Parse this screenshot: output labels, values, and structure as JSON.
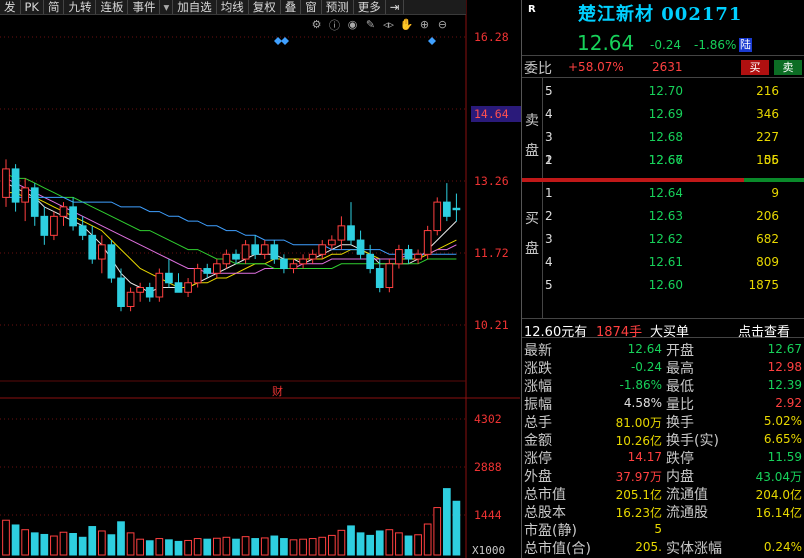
{
  "toolbar": {
    "items": [
      "发",
      "PK",
      "简",
      "九转",
      "连板",
      "事件",
      "▾",
      "加自选",
      "均线",
      "复权",
      "叠",
      "窗",
      "预测",
      "更多"
    ]
  },
  "chart": {
    "price_axis": [
      "16.28",
      "14.64",
      "13.26",
      "11.72",
      "10.21"
    ],
    "volume_axis": [
      "4302",
      "2888",
      "1444"
    ],
    "volume_unit": "X1000",
    "event_marker": "财",
    "current_price_tag": "14.64"
  },
  "stock": {
    "tag": "R",
    "name": "楚江新材",
    "code": "002171",
    "price": "12.64",
    "change": "-0.24",
    "change_pct": "-1.86%",
    "market_badge": "陆"
  },
  "weibi": {
    "label": "委比",
    "ratio": "+58.07%",
    "diff": "2631",
    "buy_label": "买",
    "sell_label": "卖"
  },
  "book": {
    "sell_label_chars": [
      "卖",
      "盘"
    ],
    "buy_label_chars": [
      "买",
      "盘"
    ],
    "asks": [
      {
        "level": "5",
        "price": "12.70",
        "qty": "216"
      },
      {
        "level": "4",
        "price": "12.69",
        "qty": "346"
      },
      {
        "level": "3",
        "price": "12.68",
        "qty": "227"
      },
      {
        "level": "2",
        "price": "12.67",
        "qty": "106"
      },
      {
        "level": "1",
        "price": "12.66",
        "qty": "55"
      }
    ],
    "bids": [
      {
        "level": "1",
        "price": "12.64",
        "qty": "9"
      },
      {
        "level": "2",
        "price": "12.63",
        "qty": "206"
      },
      {
        "level": "3",
        "price": "12.62",
        "qty": "682"
      },
      {
        "level": "4",
        "price": "12.61",
        "qty": "809"
      },
      {
        "level": "5",
        "price": "12.60",
        "qty": "1875"
      }
    ]
  },
  "big_order": {
    "price": "12.60元有",
    "qty": "1874手",
    "label": "大买单",
    "link": "点击查看"
  },
  "stats": [
    {
      "l1": "最新",
      "v1": "12.64",
      "c1": "green",
      "l2": "开盘",
      "v2": "12.67",
      "c2": "green"
    },
    {
      "l1": "涨跌",
      "v1": "-0.24",
      "c1": "green",
      "l2": "最高",
      "v2": "12.98",
      "c2": "red"
    },
    {
      "l1": "涨幅",
      "v1": "-1.86%",
      "c1": "green",
      "l2": "最低",
      "v2": "12.39",
      "c2": "green"
    },
    {
      "l1": "振幅",
      "v1": "4.58%",
      "c1": "white",
      "l2": "量比",
      "v2": "2.92",
      "c2": "red"
    },
    {
      "l1": "总手",
      "v1": "81.00万",
      "c1": "yellow",
      "l2": "换手",
      "v2": "5.02%",
      "c2": "yellow"
    },
    {
      "l1": "金额",
      "v1": "10.26亿",
      "c1": "yellow",
      "l2": "换手(实)",
      "v2": "6.65%",
      "c2": "yellow"
    },
    {
      "l1": "涨停",
      "v1": "14.17",
      "c1": "red",
      "l2": "跌停",
      "v2": "11.59",
      "c2": "green"
    },
    {
      "l1": "外盘",
      "v1": "37.97万",
      "c1": "red",
      "l2": "内盘",
      "v2": "43.04万",
      "c2": "green"
    },
    {
      "l1": "总市值",
      "v1": "205.1亿",
      "c1": "yellow",
      "l2": "流通值",
      "v2": "204.0亿",
      "c2": "yellow"
    },
    {
      "l1": "总股本",
      "v1": "16.23亿",
      "c1": "yellow",
      "l2": "流通股",
      "v2": "16.14亿",
      "c2": "yellow"
    },
    {
      "l1": "市盈(静)",
      "v1": "5",
      "c1": "yellow",
      "l2": "",
      "v2": "",
      "c2": "yellow"
    },
    {
      "l1": "总市值(合)",
      "v1": "205.",
      "c1": "yellow",
      "l2": "实体涨幅",
      "v2": "0.24%",
      "c2": "yellow"
    }
  ],
  "colors": {
    "up": "#ff4040",
    "down": "#17d15a",
    "stock_name": "#00d0ff",
    "ma_white": "#e8e8e8",
    "ma_yellow": "#e8d800",
    "ma_pink": "#e070e0",
    "ma_green": "#30d030",
    "ma_blue": "#3fa0ff"
  },
  "chart_data": {
    "type": "candlestick",
    "ylim": [
      10.21,
      16.28
    ],
    "candles": [
      {
        "o": 12.9,
        "h": 13.7,
        "l": 12.7,
        "c": 13.5
      },
      {
        "o": 13.5,
        "h": 13.6,
        "l": 12.6,
        "c": 12.8
      },
      {
        "o": 12.8,
        "h": 13.3,
        "l": 12.4,
        "c": 13.1
      },
      {
        "o": 13.1,
        "h": 13.2,
        "l": 12.3,
        "c": 12.5
      },
      {
        "o": 12.5,
        "h": 12.7,
        "l": 11.9,
        "c": 12.1
      },
      {
        "o": 12.1,
        "h": 12.6,
        "l": 12.0,
        "c": 12.5
      },
      {
        "o": 12.5,
        "h": 12.8,
        "l": 12.3,
        "c": 12.7
      },
      {
        "o": 12.7,
        "h": 12.9,
        "l": 12.2,
        "c": 12.3
      },
      {
        "o": 12.3,
        "h": 12.5,
        "l": 12.0,
        "c": 12.1
      },
      {
        "o": 12.1,
        "h": 12.3,
        "l": 11.5,
        "c": 11.6
      },
      {
        "o": 11.6,
        "h": 12.1,
        "l": 11.3,
        "c": 11.9
      },
      {
        "o": 11.9,
        "h": 12.0,
        "l": 11.1,
        "c": 11.2
      },
      {
        "o": 11.2,
        "h": 11.4,
        "l": 10.5,
        "c": 10.6
      },
      {
        "o": 10.6,
        "h": 11.0,
        "l": 10.5,
        "c": 10.9
      },
      {
        "o": 10.9,
        "h": 11.1,
        "l": 10.7,
        "c": 11.0
      },
      {
        "o": 11.0,
        "h": 11.1,
        "l": 10.7,
        "c": 10.8
      },
      {
        "o": 10.8,
        "h": 11.4,
        "l": 10.7,
        "c": 11.3
      },
      {
        "o": 11.3,
        "h": 11.6,
        "l": 11.0,
        "c": 11.1
      },
      {
        "o": 11.1,
        "h": 11.3,
        "l": 10.9,
        "c": 10.9
      },
      {
        "o": 10.9,
        "h": 11.2,
        "l": 10.8,
        "c": 11.1
      },
      {
        "o": 11.1,
        "h": 11.5,
        "l": 11.0,
        "c": 11.4
      },
      {
        "o": 11.4,
        "h": 11.5,
        "l": 11.2,
        "c": 11.3
      },
      {
        "o": 11.3,
        "h": 11.6,
        "l": 11.2,
        "c": 11.5
      },
      {
        "o": 11.5,
        "h": 11.8,
        "l": 11.4,
        "c": 11.7
      },
      {
        "o": 11.7,
        "h": 11.8,
        "l": 11.5,
        "c": 11.6
      },
      {
        "o": 11.6,
        "h": 12.0,
        "l": 11.5,
        "c": 11.9
      },
      {
        "o": 11.9,
        "h": 12.1,
        "l": 11.6,
        "c": 11.7
      },
      {
        "o": 11.7,
        "h": 12.0,
        "l": 11.6,
        "c": 11.9
      },
      {
        "o": 11.9,
        "h": 12.0,
        "l": 11.5,
        "c": 11.6
      },
      {
        "o": 11.6,
        "h": 11.7,
        "l": 11.3,
        "c": 11.4
      },
      {
        "o": 11.4,
        "h": 11.6,
        "l": 11.3,
        "c": 11.5
      },
      {
        "o": 11.5,
        "h": 11.7,
        "l": 11.4,
        "c": 11.6
      },
      {
        "o": 11.6,
        "h": 11.8,
        "l": 11.5,
        "c": 11.7
      },
      {
        "o": 11.7,
        "h": 12.0,
        "l": 11.6,
        "c": 11.9
      },
      {
        "o": 11.9,
        "h": 12.1,
        "l": 11.8,
        "c": 12.0
      },
      {
        "o": 12.0,
        "h": 12.5,
        "l": 11.8,
        "c": 12.3
      },
      {
        "o": 12.3,
        "h": 12.8,
        "l": 11.9,
        "c": 12.0
      },
      {
        "o": 12.0,
        "h": 12.2,
        "l": 11.6,
        "c": 11.7
      },
      {
        "o": 11.7,
        "h": 11.9,
        "l": 11.3,
        "c": 11.4
      },
      {
        "o": 11.4,
        "h": 11.6,
        "l": 10.9,
        "c": 11.0
      },
      {
        "o": 11.0,
        "h": 11.6,
        "l": 10.9,
        "c": 11.5
      },
      {
        "o": 11.5,
        "h": 11.9,
        "l": 11.4,
        "c": 11.8
      },
      {
        "o": 11.8,
        "h": 11.9,
        "l": 11.5,
        "c": 11.6
      },
      {
        "o": 11.6,
        "h": 11.8,
        "l": 11.5,
        "c": 11.7
      },
      {
        "o": 11.7,
        "h": 12.3,
        "l": 11.6,
        "c": 12.2
      },
      {
        "o": 12.2,
        "h": 12.9,
        "l": 12.1,
        "c": 12.8
      },
      {
        "o": 12.8,
        "h": 13.2,
        "l": 12.4,
        "c": 12.5
      },
      {
        "o": 12.67,
        "h": 12.98,
        "l": 12.39,
        "c": 12.64
      }
    ],
    "ma_lines": [
      {
        "name": "ma5",
        "values": [
          13.2,
          13.1,
          13.0,
          12.9,
          12.7,
          12.6,
          12.5,
          12.4,
          12.3,
          12.1,
          11.9,
          11.6,
          11.3,
          11.1,
          11.0,
          10.9,
          11.0,
          11.0,
          11.0,
          11.0,
          11.1,
          11.2,
          11.3,
          11.4,
          11.5,
          11.6,
          11.7,
          11.7,
          11.7,
          11.6,
          11.6,
          11.5,
          11.6,
          11.7,
          11.8,
          11.9,
          11.9,
          11.8,
          11.7,
          11.5,
          11.5,
          11.5,
          11.5,
          11.6,
          11.8,
          12.0,
          12.2,
          12.4
        ]
      },
      {
        "name": "ma10",
        "values": [
          13.0,
          13.0,
          12.9,
          12.9,
          12.8,
          12.7,
          12.6,
          12.5,
          12.4,
          12.3,
          12.2,
          12.0,
          11.8,
          11.6,
          11.4,
          11.3,
          11.2,
          11.1,
          11.0,
          11.0,
          11.1,
          11.1,
          11.2,
          11.2,
          11.3,
          11.4,
          11.5,
          11.5,
          11.6,
          11.6,
          11.6,
          11.6,
          11.6,
          11.6,
          11.7,
          11.7,
          11.8,
          11.8,
          11.7,
          11.6,
          11.6,
          11.6,
          11.6,
          11.6,
          11.7,
          11.8,
          11.9,
          12.0
        ]
      },
      {
        "name": "ma20",
        "values": [
          13.3,
          13.2,
          13.1,
          13.0,
          12.9,
          12.8,
          12.7,
          12.6,
          12.5,
          12.4,
          12.3,
          12.2,
          12.1,
          12.0,
          11.9,
          11.8,
          11.7,
          11.6,
          11.5,
          11.4,
          11.4,
          11.3,
          11.3,
          11.3,
          11.3,
          11.3,
          11.3,
          11.4,
          11.4,
          11.4,
          11.4,
          11.5,
          11.5,
          11.5,
          11.6,
          11.6,
          11.6,
          11.6,
          11.6,
          11.6,
          11.6,
          11.6,
          11.7,
          11.7,
          11.7,
          11.8,
          11.8,
          11.9
        ]
      },
      {
        "name": "ma30",
        "values": [
          13.4,
          13.3,
          13.3,
          13.2,
          13.1,
          13.0,
          12.9,
          12.9,
          12.8,
          12.7,
          12.6,
          12.5,
          12.4,
          12.3,
          12.2,
          12.2,
          12.1,
          12.0,
          11.9,
          11.8,
          11.8,
          11.7,
          11.6,
          11.6,
          11.5,
          11.5,
          11.5,
          11.5,
          11.4,
          11.4,
          11.4,
          11.4,
          11.4,
          11.4,
          11.4,
          11.5,
          11.5,
          11.5,
          11.5,
          11.5,
          11.5,
          11.5,
          11.5,
          11.5,
          11.6,
          11.6,
          11.6,
          11.6
        ]
      },
      {
        "name": "ma60",
        "values": [
          12.9,
          12.9,
          12.9,
          12.9,
          12.9,
          12.9,
          12.9,
          12.8,
          12.8,
          12.8,
          12.8,
          12.8,
          12.7,
          12.7,
          12.7,
          12.6,
          12.6,
          12.5,
          12.5,
          12.4,
          12.4,
          12.3,
          12.3,
          12.2,
          12.2,
          12.1,
          12.1,
          12.0,
          12.0,
          12.0,
          11.9,
          11.9,
          11.9,
          11.9,
          11.8,
          11.8,
          11.8,
          11.8,
          11.8,
          11.8,
          11.7,
          11.7,
          11.7,
          11.7,
          11.7,
          11.7,
          11.7,
          11.7
        ]
      }
    ],
    "volume": [
      1100,
      950,
      800,
      700,
      650,
      600,
      720,
      680,
      560,
      900,
      760,
      640,
      1050,
      700,
      500,
      450,
      520,
      480,
      430,
      460,
      520,
      500,
      530,
      560,
      500,
      580,
      520,
      540,
      600,
      520,
      480,
      500,
      520,
      560,
      620,
      780,
      920,
      700,
      620,
      760,
      800,
      700,
      600,
      640,
      980,
      1500,
      2100,
      1700
    ],
    "vlim": [
      0,
      4302
    ]
  }
}
